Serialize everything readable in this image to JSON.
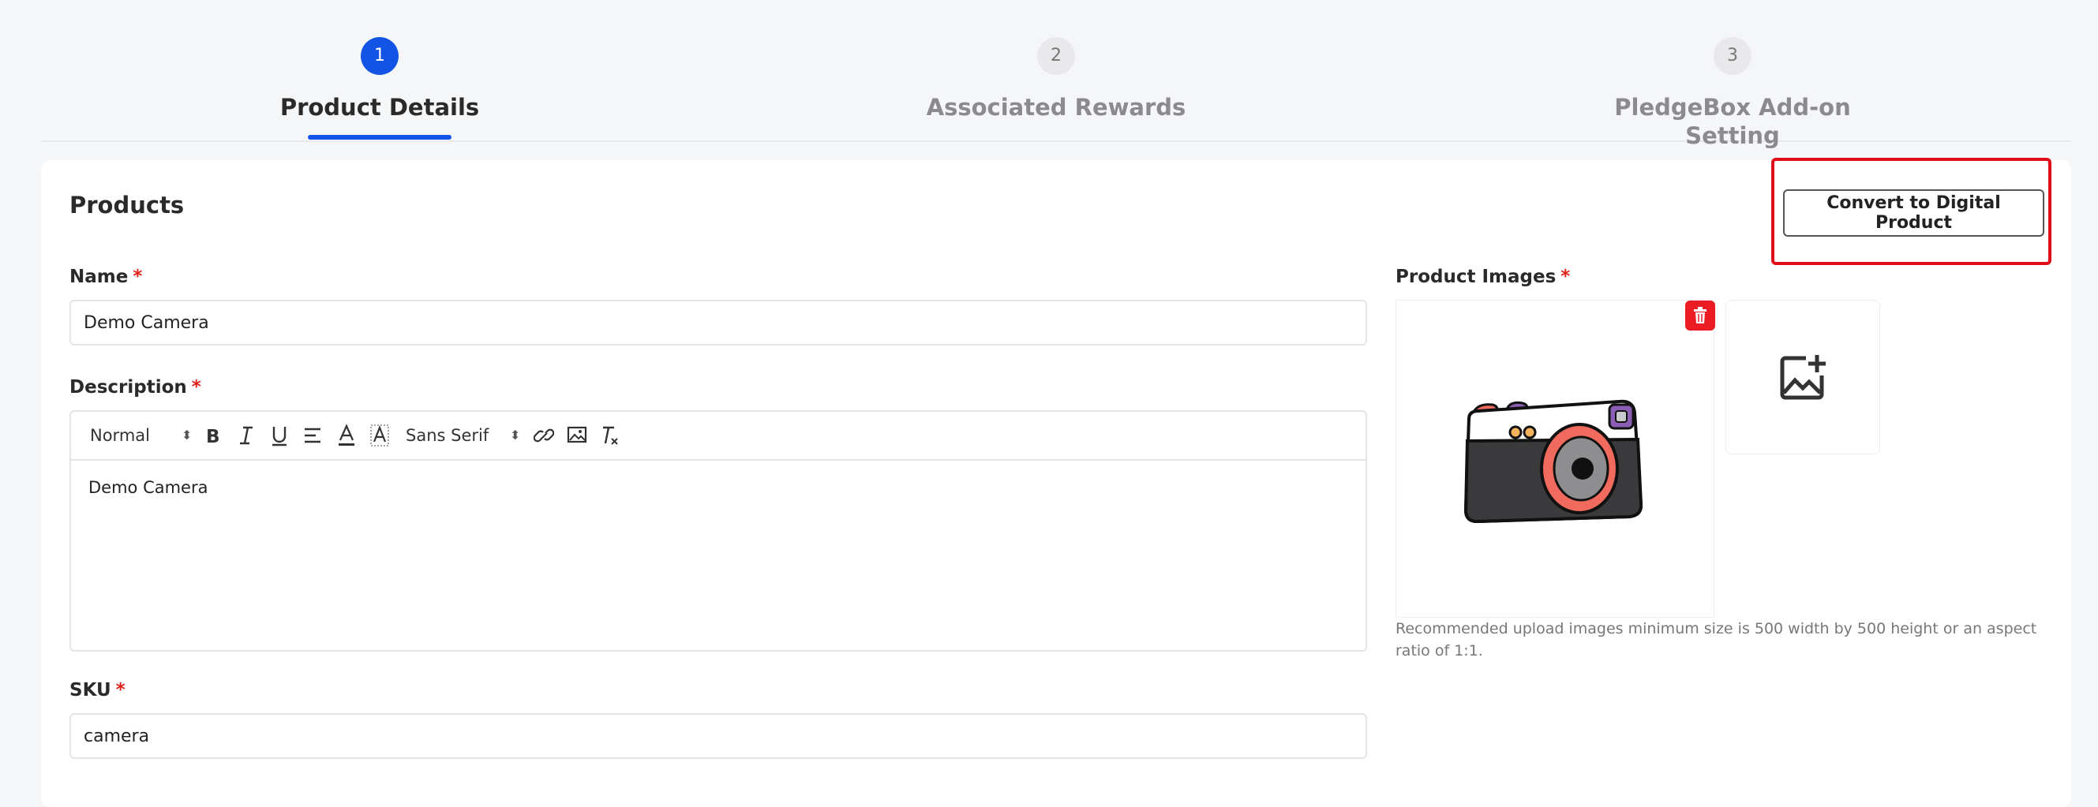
{
  "stepper": {
    "steps": [
      {
        "number": "1",
        "label": "Product Details",
        "active": true
      },
      {
        "number": "2",
        "label": "Associated Rewards",
        "active": false
      },
      {
        "number": "3",
        "label": "PledgeBox Add-on Setting",
        "active": false
      }
    ]
  },
  "card": {
    "title": "Products",
    "convert_button_label": "Convert to Digital Product"
  },
  "form": {
    "required_marker": "*",
    "name_label": "Name",
    "name_value": "Demo Camera",
    "description_label": "Description",
    "description_value": "Demo Camera",
    "toolbar": {
      "heading_select": "Normal",
      "font_select": "Sans Serif",
      "icons": [
        "bold-icon",
        "italic-icon",
        "underline-icon",
        "align-icon",
        "text-color-icon",
        "background-color-icon",
        "link-icon",
        "image-icon",
        "clear-format-icon"
      ]
    },
    "sku_label": "SKU",
    "sku_value": "camera"
  },
  "images": {
    "label": "Product Images",
    "help_text": "Recommended upload images minimum size is 500 width by 500 height or an aspect ratio of 1:1.",
    "icons": [
      "trash-icon",
      "add-image-icon",
      "camera-illustration"
    ]
  },
  "colors": {
    "accent": "#1254e6",
    "required": "#e0241c",
    "highlight": "#e00e18",
    "delete": "#ec1d22"
  }
}
